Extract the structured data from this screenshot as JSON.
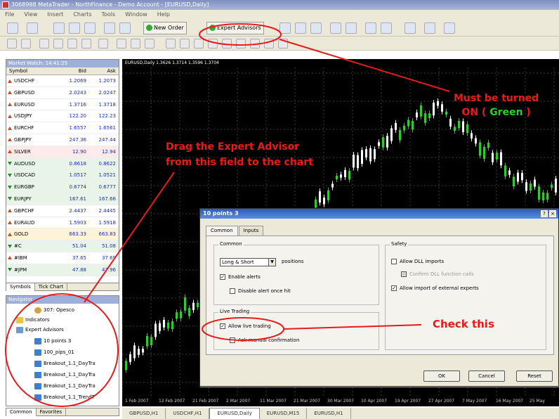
{
  "window": {
    "title": "3068988 MetaTrader - NorthFinance - Demo Account - [EURUSD,Daily]"
  },
  "menu": [
    "File",
    "View",
    "Insert",
    "Charts",
    "Tools",
    "Window",
    "Help"
  ],
  "toolbar": {
    "new_order": "New Order",
    "expert_advisors": "Expert Advisors"
  },
  "market_watch": {
    "title": "Market Watch: 14:41:25",
    "headers": {
      "symbol": "Symbol",
      "bid": "Bid",
      "ask": "Ask"
    },
    "rows": [
      {
        "symbol": "USDCHF",
        "bid": "1.2069",
        "ask": "1.2073",
        "dir": "up"
      },
      {
        "symbol": "GBPUSD",
        "bid": "2.0243",
        "ask": "2.0247",
        "dir": "up"
      },
      {
        "symbol": "EURUSD",
        "bid": "1.3716",
        "ask": "1.3718",
        "dir": "up"
      },
      {
        "symbol": "USDJPY",
        "bid": "122.20",
        "ask": "122.23",
        "dir": "up"
      },
      {
        "symbol": "EURCHF",
        "bid": "1.6557",
        "ask": "1.6561",
        "dir": "up"
      },
      {
        "symbol": "GBPJPY",
        "bid": "247.36",
        "ask": "247.44",
        "dir": "up"
      },
      {
        "symbol": "SILVER",
        "bid": "12.90",
        "ask": "12.94",
        "dir": "up"
      },
      {
        "symbol": "AUDUSD",
        "bid": "0.8618",
        "ask": "0.8622",
        "dir": "dn"
      },
      {
        "symbol": "USDCAD",
        "bid": "1.0517",
        "ask": "1.0521",
        "dir": "dn"
      },
      {
        "symbol": "EURGBP",
        "bid": "0.6774",
        "ask": "0.6777",
        "dir": "dn"
      },
      {
        "symbol": "EURJPY",
        "bid": "167.61",
        "ask": "167.66",
        "dir": "dn"
      },
      {
        "symbol": "GBPCHF",
        "bid": "2.4437",
        "ask": "2.4445",
        "dir": "up"
      },
      {
        "symbol": "EURAUD",
        "bid": "1.5903",
        "ask": "1.5918",
        "dir": "up"
      },
      {
        "symbol": "GOLD",
        "bid": "663.33",
        "ask": "663.83",
        "dir": "up"
      },
      {
        "symbol": "#C",
        "bid": "51.04",
        "ask": "51.08",
        "dir": "dn"
      },
      {
        "symbol": "#IBM",
        "bid": "37.65",
        "ask": "37.69",
        "dir": "up"
      },
      {
        "symbol": "#JPM",
        "bid": "47.88",
        "ask": "47.96",
        "dir": "dn"
      }
    ],
    "tabs": [
      "Symbols",
      "Tick Chart"
    ]
  },
  "navigator": {
    "title": "Navigator",
    "items": [
      {
        "label": "307: Opesco",
        "indent": 2
      },
      {
        "label": "Indicators",
        "indent": 1
      },
      {
        "label": "Expert Advisors",
        "indent": 1
      },
      {
        "label": "10 points 3",
        "indent": 2
      },
      {
        "label": "100_pips_01",
        "indent": 2
      },
      {
        "label": "Breakout_1.1_DayTra",
        "indent": 2
      },
      {
        "label": "Breakout_1.1_DayTra",
        "indent": 2
      },
      {
        "label": "Breakout_1.1_DayTra",
        "indent": 2
      },
      {
        "label": "Breakout_1.1_TrendT",
        "indent": 2
      }
    ],
    "tabs": [
      "Common",
      "Favorites"
    ]
  },
  "chart": {
    "header": "EURUSD,Daily 1.3626 1.3714 1.3596 1.3704",
    "x_labels": [
      "1 Feb 2007",
      "12 Feb 2007",
      "21 Feb 2007",
      "2 Mar 2007",
      "11 Mar 2007",
      "21 Mar 2007",
      "30 Mar 2007",
      "10 Apr 2007",
      "19 Apr 2007",
      "27 Apr 2007",
      "7 May 2007",
      "16 May 2007",
      "25 May"
    ],
    "tabs": [
      "GBPUSD,H1",
      "USDCHF,H1",
      "EURUSD,Daily",
      "EURUSD,M15",
      "EURUSD,H1"
    ]
  },
  "dialog": {
    "title": "10 points 3",
    "tabs": [
      "Common",
      "Inputs"
    ],
    "common_group": "Common",
    "positions_value": "Long & Short",
    "positions_suffix": "positions",
    "enable_alerts": "Enable alerts",
    "disable_alert": "Disable alert once hit",
    "live_trading_group": "Live Trading",
    "allow_live_trading": "Allow live trading",
    "ask_manual": "Ask manual confirmation",
    "safety_group": "Safety",
    "allow_dll": "Allow DLL imports",
    "confirm_dll": "Confirm DLL function calls",
    "allow_import": "Allow import of external experts",
    "ok": "OK",
    "cancel": "Cancel",
    "reset": "Reset"
  },
  "annotations": {
    "must_be_on_1": "Must be turned",
    "must_be_on_2a": "ON ( ",
    "must_be_on_green": "Green",
    "must_be_on_2b": " )",
    "drag_1": "Drag the Expert Advisor",
    "drag_2": "from this field to the chart",
    "check_this": "Check this"
  },
  "colors": {
    "annotation": "#e81a1a",
    "green_note": "#2ecc2e",
    "chart_bg": "#000000",
    "bull_candle": "#ffffff",
    "bear_candle": "#2ecc2e"
  }
}
